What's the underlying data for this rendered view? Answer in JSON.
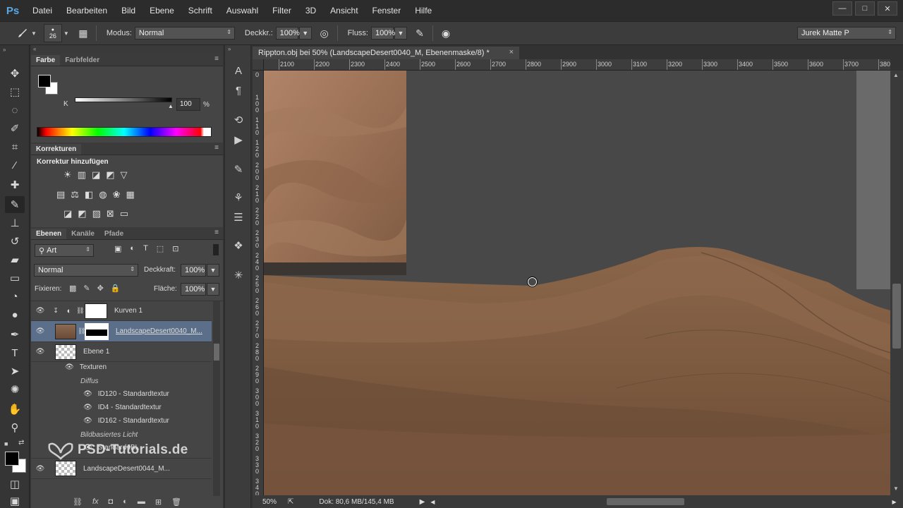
{
  "app": {
    "logo": "Ps"
  },
  "menu": [
    "Datei",
    "Bearbeiten",
    "Bild",
    "Ebene",
    "Schrift",
    "Auswahl",
    "Filter",
    "3D",
    "Ansicht",
    "Fenster",
    "Hilfe"
  ],
  "options": {
    "brush_size": "26",
    "modus_label": "Modus:",
    "modus_value": "Normal",
    "deckkr_label": "Deckkr.:",
    "deckkr_value": "100%",
    "fluss_label": "Fluss:",
    "fluss_value": "100%",
    "workspace": "Jurek Matte P"
  },
  "color_panel": {
    "tabs": [
      "Farbe",
      "Farbfelder"
    ],
    "channel": "K",
    "value": "100",
    "unit": "%"
  },
  "corrections_panel": {
    "tab": "Korrekturen",
    "heading": "Korrektur hinzufügen"
  },
  "layers_panel": {
    "tabs": [
      "Ebenen",
      "Kanäle",
      "Pfade"
    ],
    "filter": "Art",
    "blend": "Normal",
    "opacity_label": "Deckkraft:",
    "opacity_value": "100%",
    "lock_label": "Fixieren:",
    "fill_label": "Fläche:",
    "fill_value": "100%",
    "layers": [
      {
        "name": "Kurven 1"
      },
      {
        "name": "LandscapeDesert0040_M..."
      },
      {
        "name": "Ebene 1"
      },
      {
        "name": "LandscapeDesert0044_M..."
      }
    ],
    "textures_label": "Texturen",
    "diffus_label": "Diffus",
    "textures": [
      "ID120 - Standardtextur",
      "ID4 - Standardtextur",
      "ID162 - Standardtextur"
    ],
    "ibl_label": "Bildbasiertes Licht",
    "ibl_item": "Standard IBL"
  },
  "document": {
    "tab_title": "Rippton.obj bei 50% (LandscapeDesert0040_M, Ebenenmaske/8) *",
    "close": "×",
    "ruler_top": [
      "2100",
      "2200",
      "2300",
      "2400",
      "2500",
      "2600",
      "2700",
      "2800",
      "2900",
      "3000",
      "3100",
      "3200",
      "3300",
      "3400",
      "3500",
      "3600",
      "3700",
      "380"
    ],
    "ruler_left": [
      "0",
      "1 0 0",
      "1 1 0",
      "1 2 0",
      "2 0 0",
      "2 1 0",
      "2 2 0",
      "2 3 0",
      "2 4 0",
      "2 5 0",
      "2 6 0",
      "2 7 0",
      "2 8 0",
      "2 9 0",
      "3 0 0",
      "3 1 0",
      "3 2 0",
      "3 3 0",
      "3 4 0"
    ]
  },
  "status": {
    "zoom": "50%",
    "doc": "Dok: 80,6 MB/145,4 MB"
  },
  "watermark": "PSD-Tutorials.de"
}
